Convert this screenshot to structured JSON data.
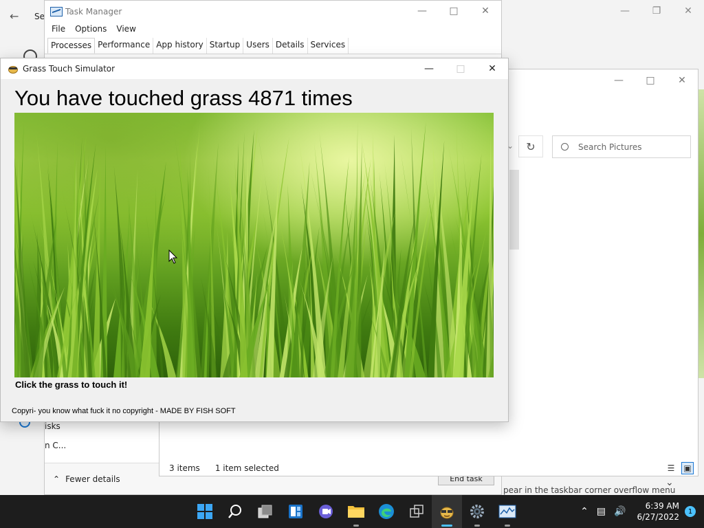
{
  "settings": {
    "title": "Se",
    "bottom_text": "pear in the taskbar corner overflow menu"
  },
  "task_manager": {
    "title": "Task Manager",
    "menu": [
      "File",
      "Options",
      "View"
    ],
    "tabs": [
      "Processes",
      "Performance",
      "App history",
      "Startup",
      "Users",
      "Details",
      "Services"
    ],
    "row1": "isks",
    "row2": "n C...",
    "fewer_details": "Fewer details",
    "end_task": "End task"
  },
  "explorer": {
    "search_placeholder": "Search Pictures",
    "item_count": "3 items",
    "selection": "1 item selected"
  },
  "grass_app": {
    "title": "Grass Touch Simulator",
    "heading": "You have touched grass 4871 times",
    "instruction": "Click the grass to touch it!",
    "copyright": "Copyri- you know what fuck it no copyright - MADE BY FISH SOFT"
  },
  "taskbar": {
    "apps": [
      "start",
      "search",
      "task-view",
      "widgets",
      "chat",
      "file-explorer",
      "edge",
      "snipping",
      "grass-touch-simulator",
      "settings",
      "task-manager"
    ],
    "active_app": "grass-touch-simulator",
    "time": "6:39 AM",
    "date": "6/27/2022",
    "notification_count": "1"
  },
  "colors": {
    "accent": "#4cc2ff",
    "taskbar_bg": "#1d1d1d",
    "grass_light": "#a6d34a",
    "grass_dark": "#2e620a"
  }
}
